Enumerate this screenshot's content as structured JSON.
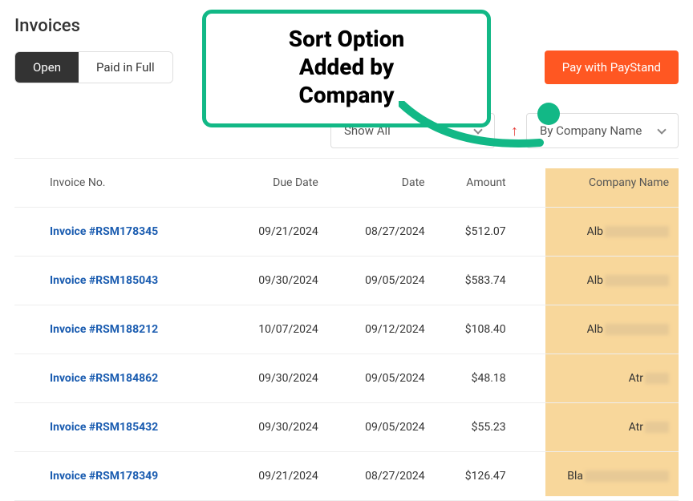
{
  "page_title": "Invoices",
  "tabs": {
    "open": "Open",
    "paid": "Paid in Full",
    "active": "open"
  },
  "pay_button": "Pay with PayStand",
  "filter": {
    "label": "Show All"
  },
  "sort": {
    "direction": "asc",
    "label": "By Company Name"
  },
  "callout": {
    "line1": "Sort Option",
    "line2": "Added by",
    "line3": "Company"
  },
  "columns": {
    "invoice_no": "Invoice No.",
    "due_date": "Due Date",
    "date": "Date",
    "amount": "Amount",
    "company": "Company Name"
  },
  "rows": [
    {
      "invoice": "Invoice #RSM178345",
      "due": "09/21/2024",
      "date": "08/27/2024",
      "amount": "$512.07",
      "company": "Alb"
    },
    {
      "invoice": "Invoice #RSM185043",
      "due": "09/30/2024",
      "date": "09/05/2024",
      "amount": "$583.74",
      "company": "Alb"
    },
    {
      "invoice": "Invoice #RSM188212",
      "due": "10/07/2024",
      "date": "09/12/2024",
      "amount": "$108.40",
      "company": "Alb"
    },
    {
      "invoice": "Invoice #RSM184862",
      "due": "09/30/2024",
      "date": "09/05/2024",
      "amount": "$48.18",
      "company": "Atr"
    },
    {
      "invoice": "Invoice #RSM185432",
      "due": "09/30/2024",
      "date": "09/05/2024",
      "amount": "$55.23",
      "company": "Atr"
    },
    {
      "invoice": "Invoice #RSM178349",
      "due": "09/21/2024",
      "date": "08/27/2024",
      "amount": "$126.47",
      "company": "Bla"
    }
  ],
  "redact_widths": [
    80,
    80,
    80,
    30,
    30,
    105
  ]
}
